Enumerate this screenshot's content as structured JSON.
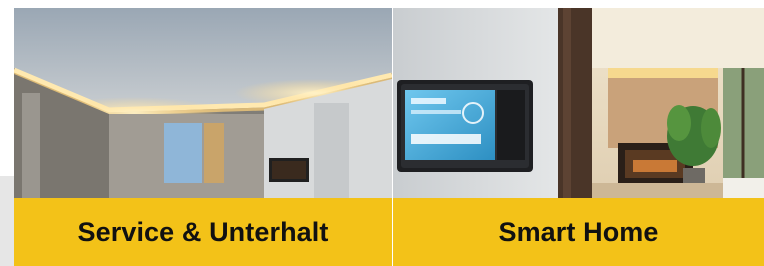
{
  "tiles": [
    {
      "title": "Service & Unterhalt"
    },
    {
      "title": "Smart Home"
    }
  ],
  "colors": {
    "caption_bg": "#f3c218",
    "caption_text": "#111111"
  }
}
